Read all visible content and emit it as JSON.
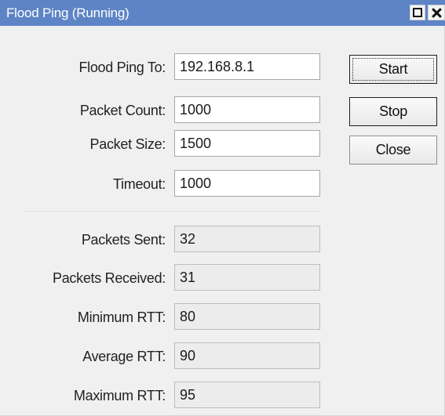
{
  "window": {
    "title": "Flood Ping (Running)"
  },
  "form": {
    "inputs": [
      {
        "label": "Flood Ping To:",
        "value": "192.168.8.1"
      },
      {
        "label": "Packet Count:",
        "value": "1000"
      },
      {
        "label": "Packet Size:",
        "value": "1500"
      },
      {
        "label": "Timeout:",
        "value": "1000"
      }
    ],
    "stats": [
      {
        "label": "Packets Sent:",
        "value": "32"
      },
      {
        "label": "Packets Received:",
        "value": "31"
      },
      {
        "label": "Minimum RTT:",
        "value": "80"
      },
      {
        "label": "Average RTT:",
        "value": "90"
      },
      {
        "label": "Maximum RTT:",
        "value": "95"
      }
    ]
  },
  "buttons": {
    "start": "Start",
    "stop": "Stop",
    "close": "Close"
  },
  "colors": {
    "titlebar": "#5d84c5",
    "window_bg": "#f0f0f0"
  }
}
